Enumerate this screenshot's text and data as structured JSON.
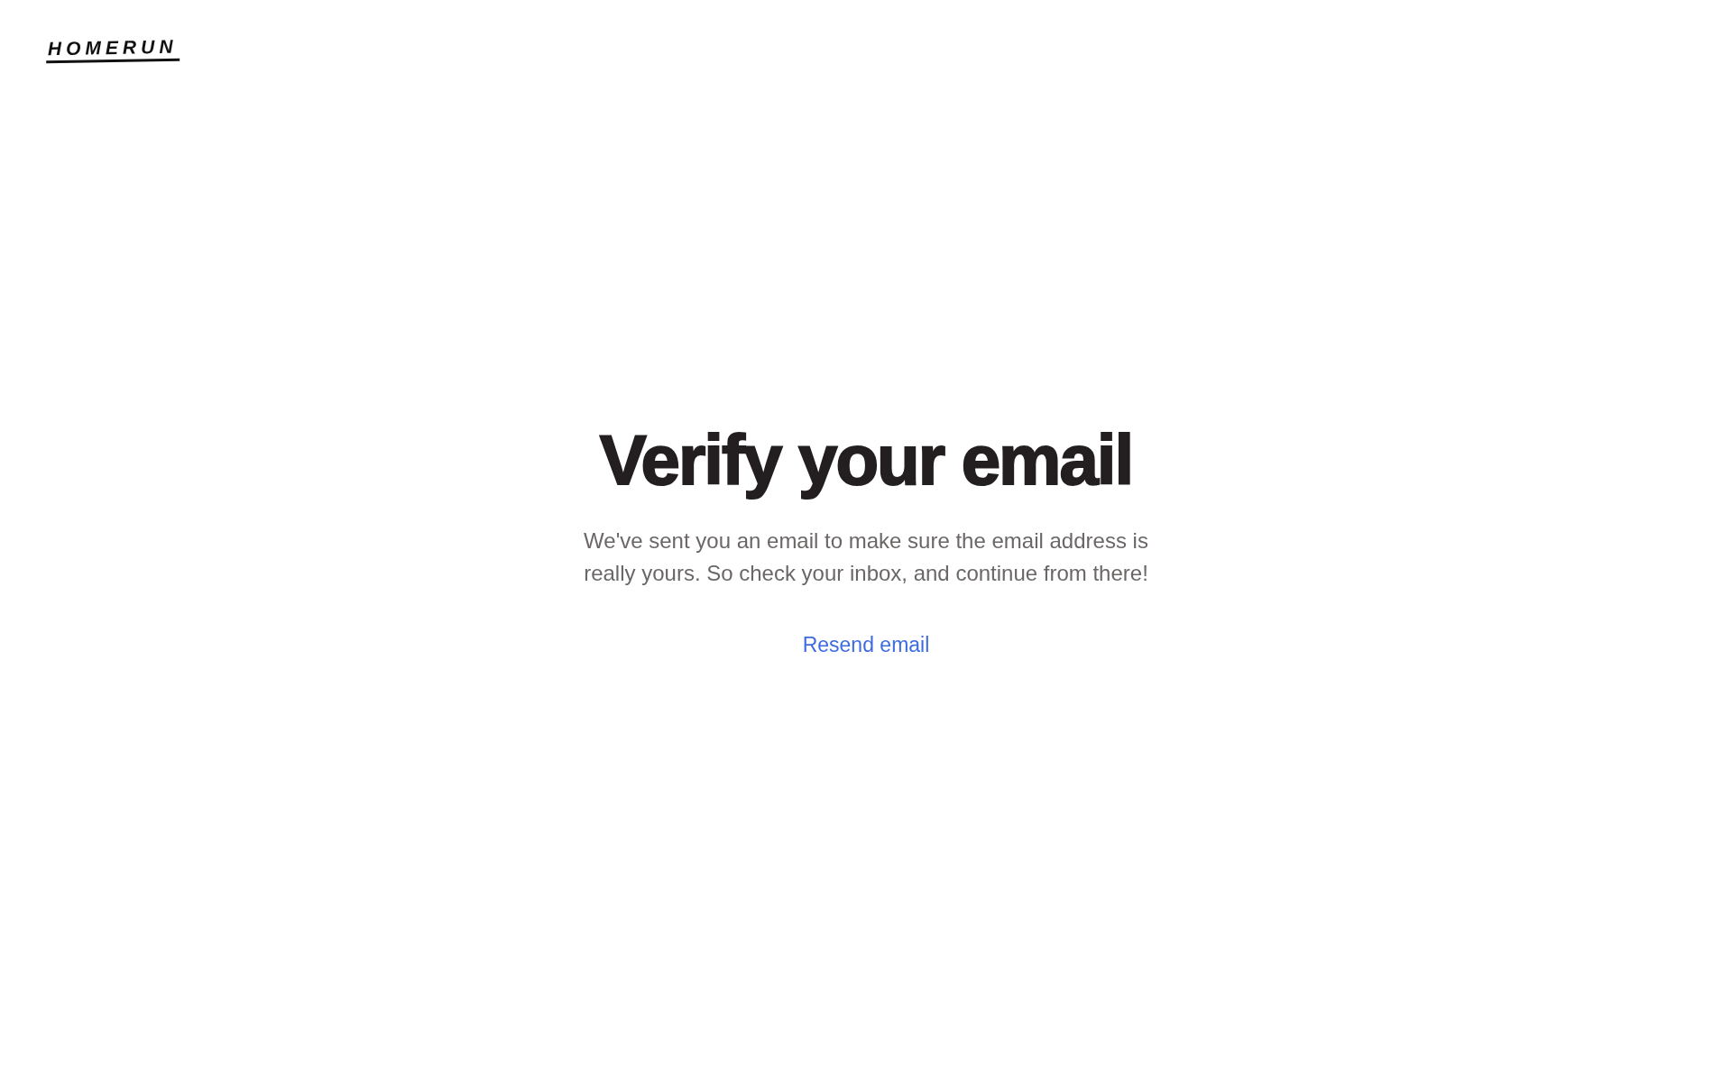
{
  "logo": "HOMERUN",
  "heading": "Verify your email",
  "message": "We've sent you an email to make sure the email address is really yours. So check your inbox, and continue from there!",
  "link": "Resend email"
}
